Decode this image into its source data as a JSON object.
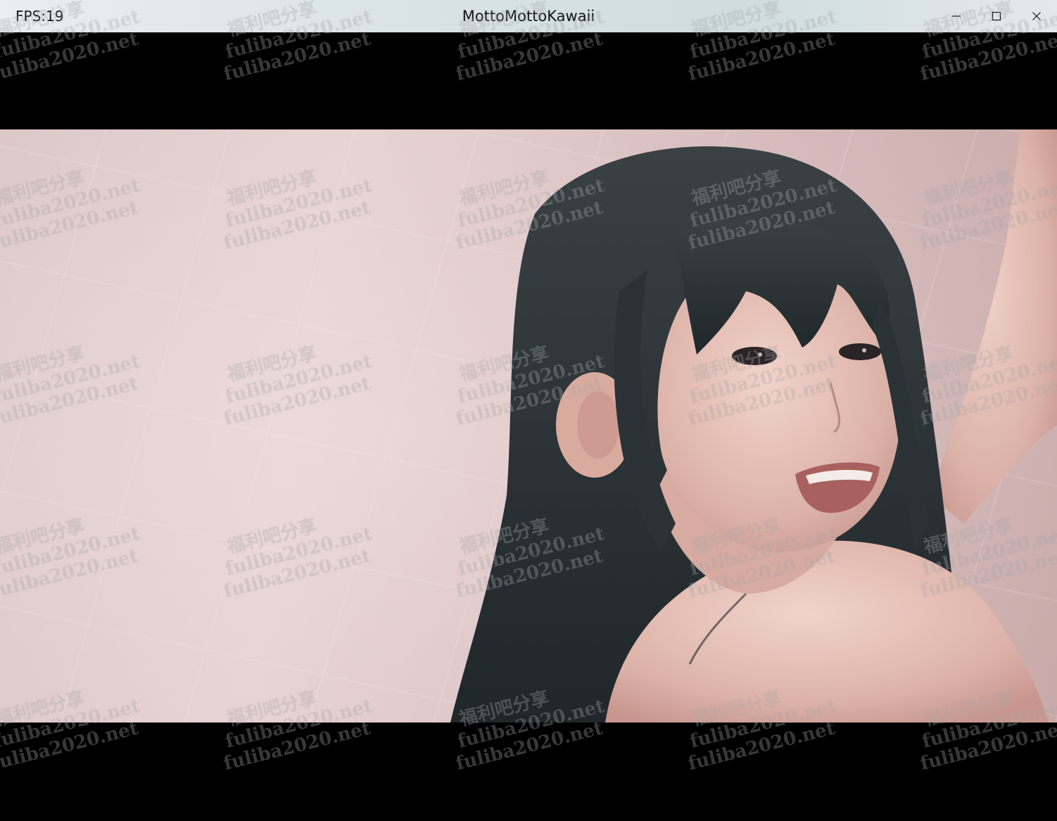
{
  "window": {
    "fps_label": "FPS:19",
    "title": "MottoMottoKawaii",
    "controls": {
      "minimize_icon": "minimize-icon",
      "maximize_icon": "maximize-icon",
      "close_icon": "close-icon"
    }
  },
  "watermark": {
    "line_cn": "福利吧分享",
    "line_url": "fuliba2020.net",
    "line_name": "fuliba2020.net"
  },
  "colors": {
    "titlebar": "#dde6e8",
    "letterbox": "#000000",
    "hair": "#2c3438",
    "skin": "#e8c6bd"
  }
}
